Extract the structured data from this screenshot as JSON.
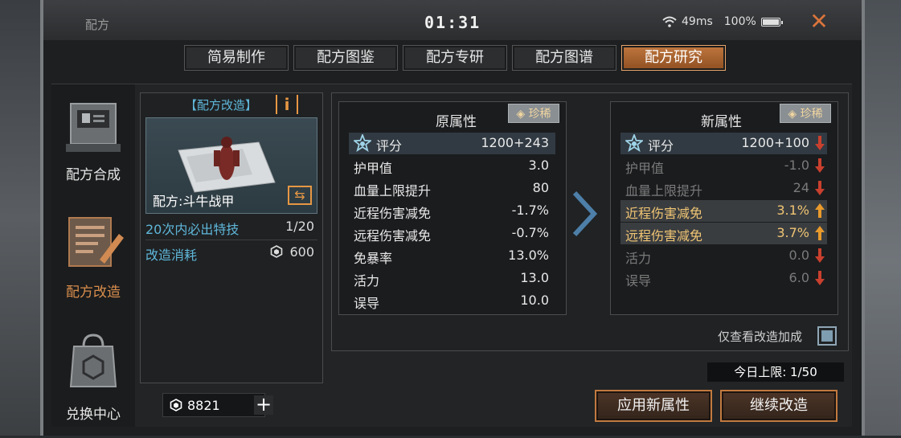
{
  "window": {
    "title": "配方",
    "time": "01:31",
    "ping": "49ms",
    "battery": "100%",
    "battery_level": 1.0
  },
  "tabs": [
    {
      "label": "简易制作",
      "active": false
    },
    {
      "label": "配方图鉴",
      "active": false
    },
    {
      "label": "配方专研",
      "active": false
    },
    {
      "label": "配方图谱",
      "active": false
    },
    {
      "label": "配方研究",
      "active": true
    }
  ],
  "sidebar": {
    "items": [
      {
        "label": "配方合成",
        "icon": "crafting-terminal-icon",
        "active": false
      },
      {
        "label": "配方改造",
        "icon": "blueprint-pencil-icon",
        "active": true
      },
      {
        "label": "兑换中心",
        "icon": "shopping-bag-icon",
        "active": false
      }
    ]
  },
  "recipe_card": {
    "header": "【配方改造】",
    "name": "配方:斗牛战甲",
    "special_label": "20次内必出特技",
    "special_count": "1/20",
    "cost_label": "改造消耗",
    "cost_value": "600"
  },
  "wallet": {
    "amount": "8821"
  },
  "original": {
    "title": "原属性",
    "rarity": "珍稀",
    "rows": [
      {
        "name": "评分",
        "value": "1200+243"
      },
      {
        "name": "护甲值",
        "value": "3.0"
      },
      {
        "name": "血量上限提升",
        "value": "80"
      },
      {
        "name": "近程伤害减免",
        "value": "-1.7%"
      },
      {
        "name": "远程伤害减免",
        "value": "-0.7%"
      },
      {
        "name": "免暴率",
        "value": "13.0%"
      },
      {
        "name": "活力",
        "value": "13.0"
      },
      {
        "name": "误导",
        "value": "10.0"
      }
    ]
  },
  "new": {
    "title": "新属性",
    "rarity": "珍稀",
    "rows": [
      {
        "name": "评分",
        "value": "1200+100",
        "trend": "down"
      },
      {
        "name": "护甲值",
        "value": "-1.0",
        "trend": "down"
      },
      {
        "name": "血量上限提升",
        "value": "24",
        "trend": "down"
      },
      {
        "name": "近程伤害减免",
        "value": "3.1%",
        "trend": "up"
      },
      {
        "name": "远程伤害减免",
        "value": "3.7%",
        "trend": "up"
      },
      {
        "name": "活力",
        "value": "0.0",
        "trend": "down"
      },
      {
        "name": "误导",
        "value": "6.0",
        "trend": "down"
      }
    ]
  },
  "filter_label": "仅查看改造加成",
  "daily_limit": "今日上限: 1/50",
  "buttons": {
    "apply": "应用新属性",
    "continue": "继续改造"
  },
  "colors": {
    "accent": "#c27a3f",
    "info_blue": "#5fb7d9",
    "gold": "#f0c574",
    "down": "#c9402e",
    "up": "#e89a2c"
  }
}
